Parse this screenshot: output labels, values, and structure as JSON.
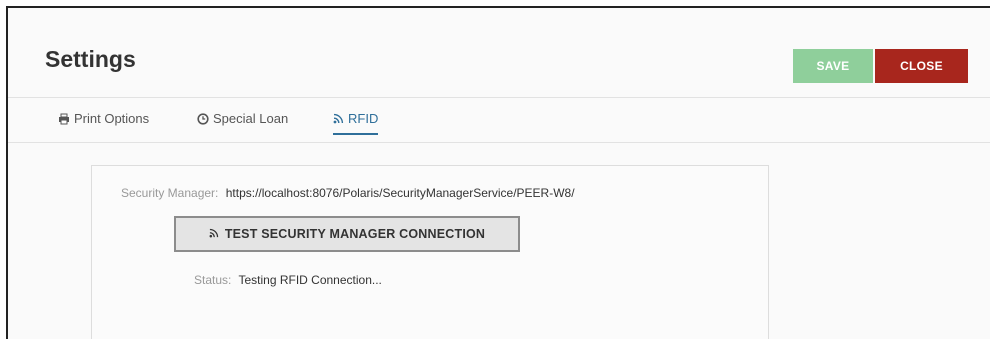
{
  "header": {
    "title": "Settings",
    "save_label": "SAVE",
    "close_label": "CLOSE"
  },
  "tabs": [
    {
      "label": "Print Options",
      "icon": "printer-icon",
      "active": false
    },
    {
      "label": "Special Loan",
      "icon": "clock-icon",
      "active": false
    },
    {
      "label": "RFID",
      "icon": "rss-icon",
      "active": true
    }
  ],
  "rfid": {
    "security_manager_label": "Security Manager:",
    "security_manager_url": "https://localhost:8076/Polaris/SecurityManagerService/PEER-W8/",
    "test_button_label": "TEST SECURITY MANAGER CONNECTION",
    "status_label": "Status:",
    "status_value": "Testing RFID Connection..."
  },
  "colors": {
    "save": "#8fcf9b",
    "close": "#a8261d",
    "active_tab": "#2f6f9a"
  }
}
